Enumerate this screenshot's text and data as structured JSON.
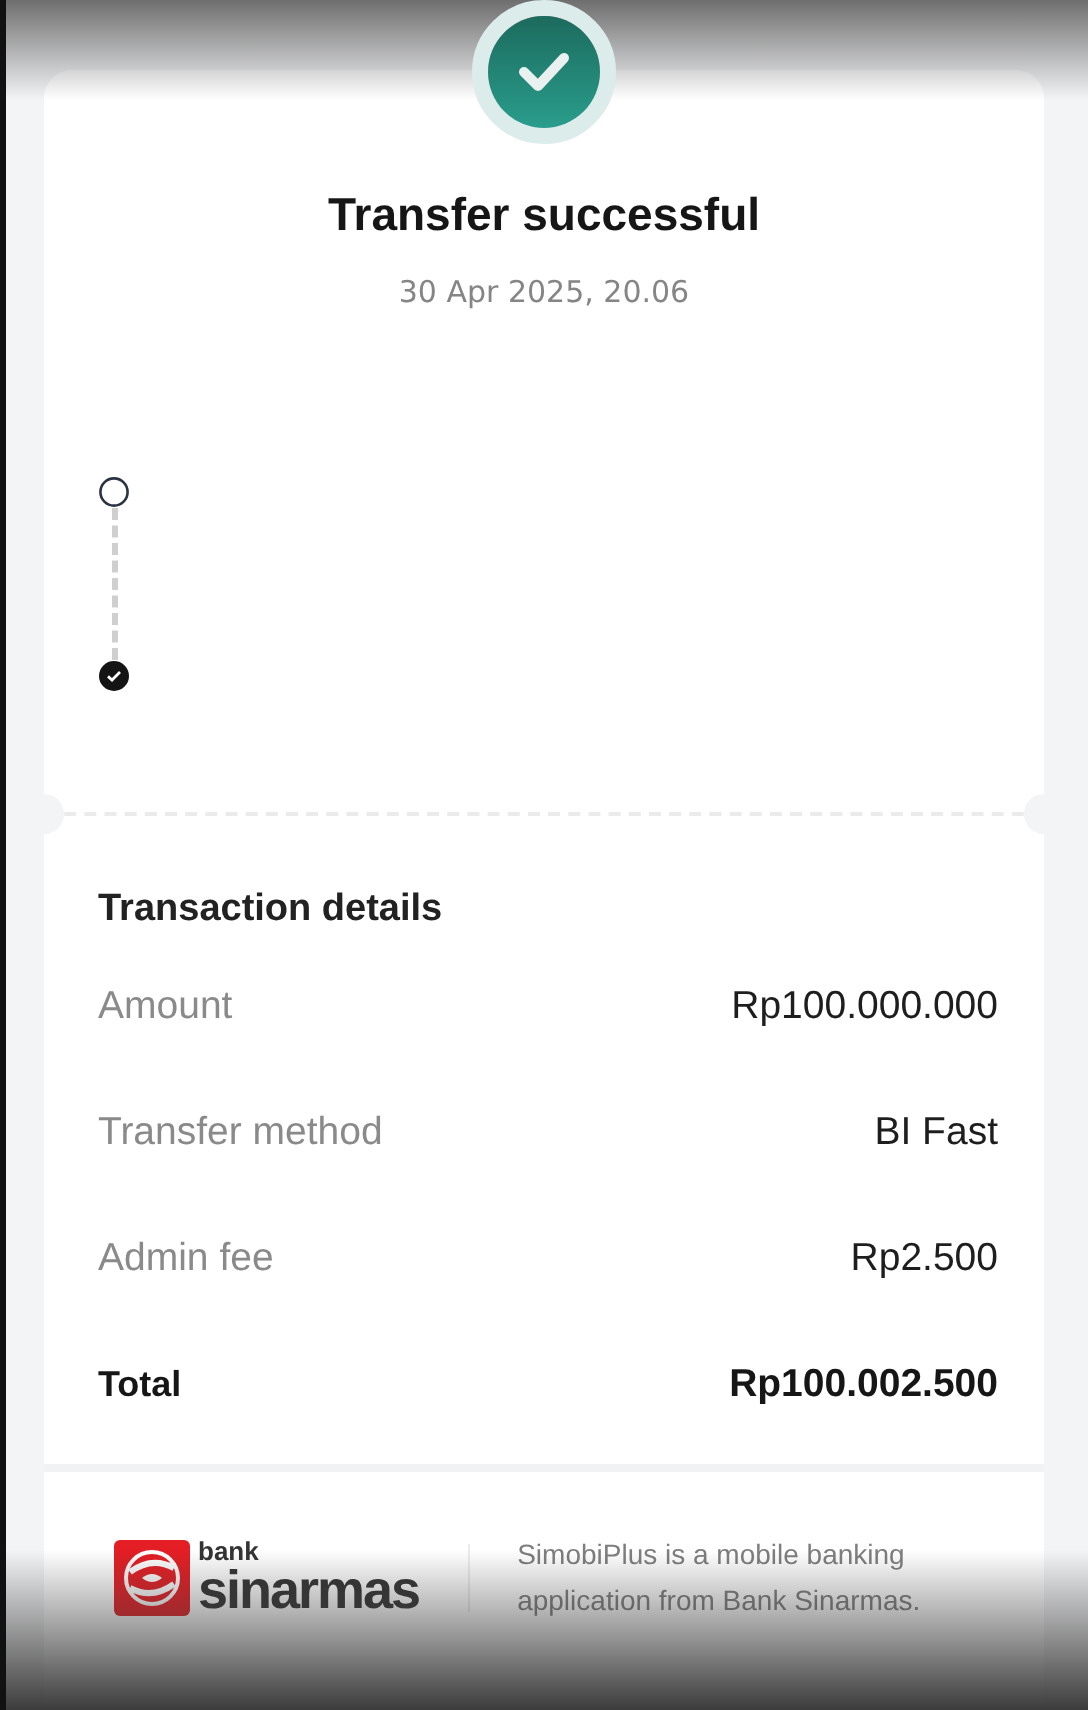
{
  "status": {
    "title": "Transfer successful",
    "datetime": "30 Apr 2025, 20.06"
  },
  "timeline": [
    {
      "checked": false
    },
    {
      "checked": true
    }
  ],
  "details": {
    "heading": "Transaction details",
    "rows": [
      {
        "kind": "normal",
        "label": "Amount",
        "value": "Rp100.000.000"
      },
      {
        "kind": "normal",
        "label": "Transfer method",
        "value": "BI Fast"
      },
      {
        "kind": "normal",
        "label": "Admin fee",
        "value": "Rp2.500"
      },
      {
        "kind": "total",
        "label": "Total",
        "value": "Rp100.002.500"
      }
    ]
  },
  "footer": {
    "logo_small": "bank",
    "logo_large": "sinarmas",
    "description": "SimobiPlus is a mobile banking application from Bank Sinarmas."
  }
}
